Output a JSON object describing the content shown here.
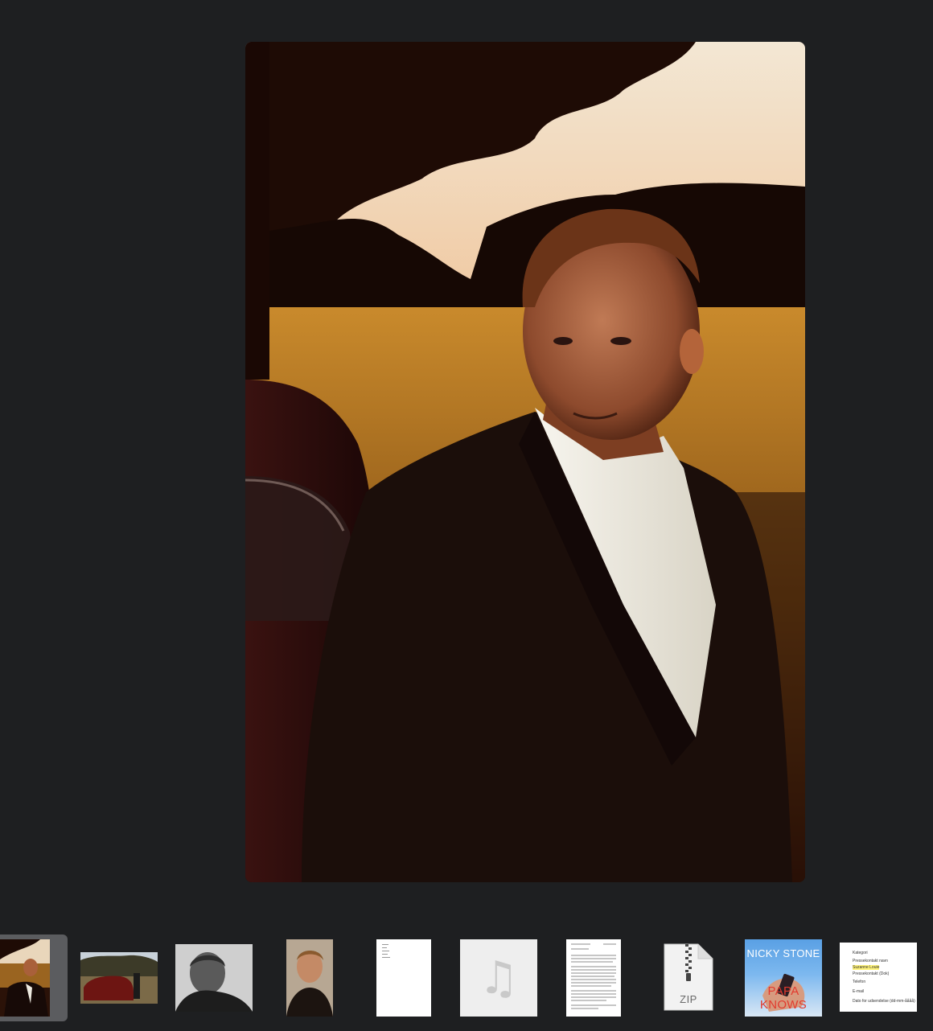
{
  "viewer": {
    "selected_index": 0,
    "main_image_icon": "portrait-photo"
  },
  "thumbnails": [
    {
      "kind": "photo",
      "icon": "portrait-photo-thumb"
    },
    {
      "kind": "photo",
      "icon": "car-photo-thumb"
    },
    {
      "kind": "photo",
      "icon": "bw-portrait-thumb"
    },
    {
      "kind": "photo",
      "icon": "leather-jacket-portrait-thumb"
    },
    {
      "kind": "document",
      "icon": "blank-document-thumb"
    },
    {
      "kind": "audio",
      "icon": "music-note-icon"
    },
    {
      "kind": "document",
      "icon": "text-document-thumb"
    },
    {
      "kind": "archive",
      "icon": "zip-icon",
      "label": "ZIP"
    },
    {
      "kind": "album",
      "icon": "album-cover-thumb",
      "artist": "NICKY STONE",
      "title": "PAPA KNOWS"
    },
    {
      "kind": "document",
      "icon": "form-document-thumb",
      "lines": [
        "Kategori",
        "Pressekontakt navn",
        "Suzanne Louie",
        "Pressekontakt (Dok)",
        "Telefon",
        "E-mail",
        "Dato for udsendelse (dd-mm-åååå)"
      ]
    }
  ],
  "colors": {
    "background": "#1e1f21",
    "selection": "#5b5c5f"
  }
}
